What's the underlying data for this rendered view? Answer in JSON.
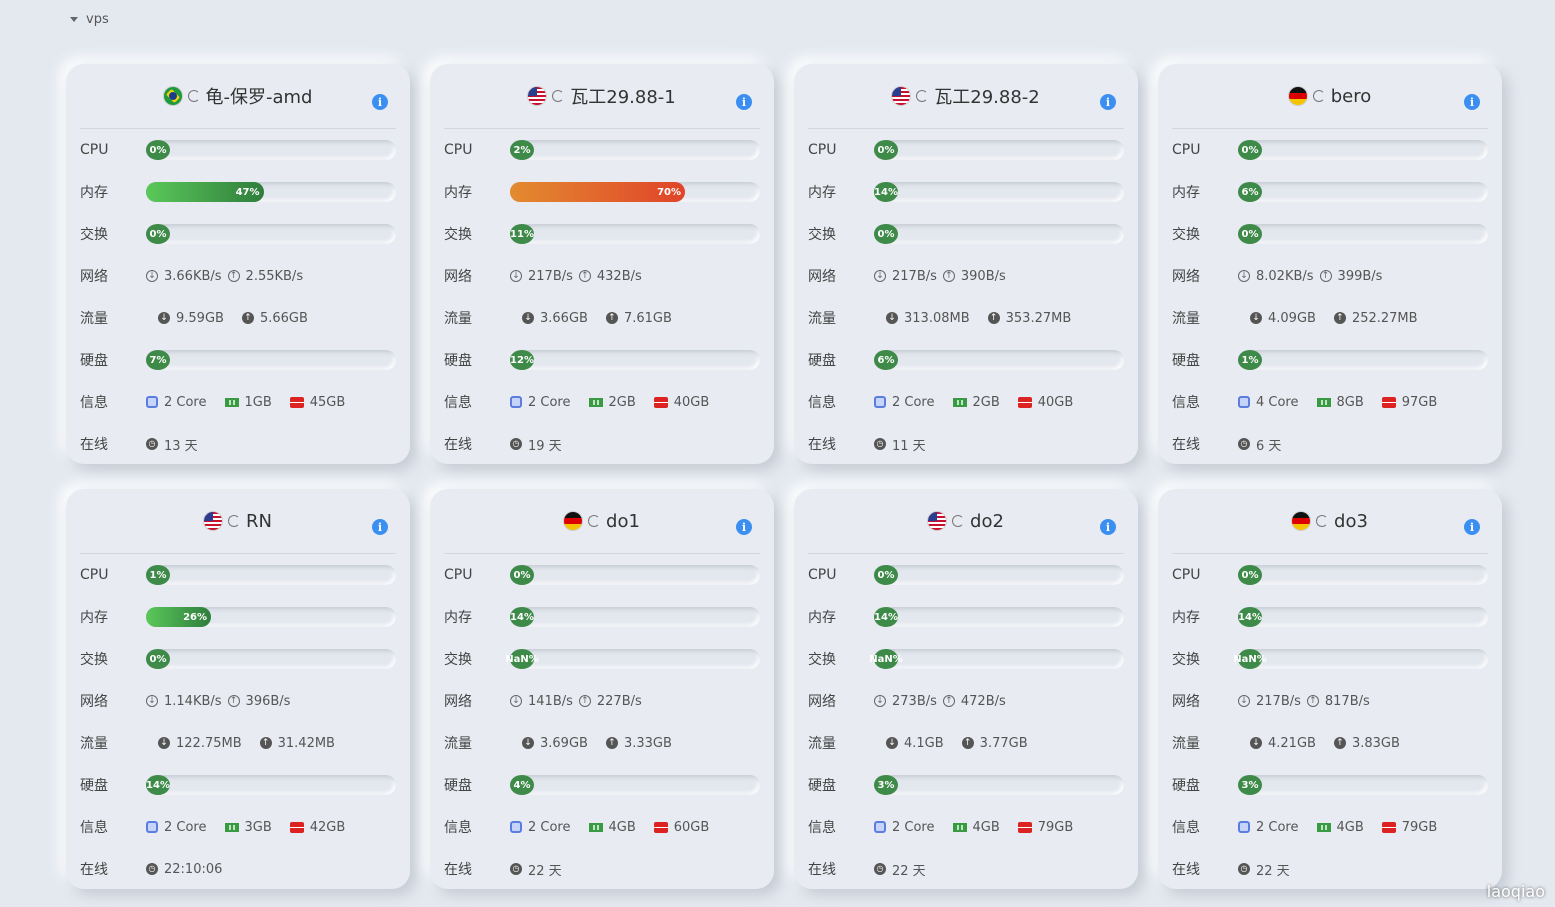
{
  "group": {
    "name": "vps"
  },
  "labels": {
    "cpu": "CPU",
    "mem": "内存",
    "swap": "交换",
    "net": "网络",
    "traffic": "流量",
    "disk": "硬盘",
    "info": "信息",
    "online": "在线"
  },
  "watermark": "laoqiao",
  "servers": [
    {
      "flag": "br",
      "name": "龟-保罗-amd",
      "cpu": "0%",
      "cpu_pct": 0,
      "mem": "47%",
      "mem_pct": 47,
      "swap": "0%",
      "swap_pct": 0,
      "net_in": "3.66KB/s",
      "net_out": "2.55KB/s",
      "traffic_in": "9.59GB",
      "traffic_out": "5.66GB",
      "disk": "7%",
      "disk_pct": 7,
      "cores": "2 Core",
      "ram": "1GB",
      "storage": "45GB",
      "online": "13 天"
    },
    {
      "flag": "us",
      "name": "瓦工29.88-1",
      "cpu": "2%",
      "cpu_pct": 2,
      "mem": "70%",
      "mem_pct": 70,
      "swap": "11%",
      "swap_pct": 11,
      "net_in": "217B/s",
      "net_out": "432B/s",
      "traffic_in": "3.66GB",
      "traffic_out": "7.61GB",
      "disk": "12%",
      "disk_pct": 12,
      "cores": "2 Core",
      "ram": "2GB",
      "storage": "40GB",
      "online": "19 天"
    },
    {
      "flag": "us",
      "name": "瓦工29.88-2",
      "cpu": "0%",
      "cpu_pct": 0,
      "mem": "14%",
      "mem_pct": 14,
      "swap": "0%",
      "swap_pct": 0,
      "net_in": "217B/s",
      "net_out": "390B/s",
      "traffic_in": "313.08MB",
      "traffic_out": "353.27MB",
      "disk": "6%",
      "disk_pct": 6,
      "cores": "2 Core",
      "ram": "2GB",
      "storage": "40GB",
      "online": "11 天"
    },
    {
      "flag": "de",
      "name": "bero",
      "cpu": "0%",
      "cpu_pct": 0,
      "mem": "6%",
      "mem_pct": 6,
      "swap": "0%",
      "swap_pct": 0,
      "net_in": "8.02KB/s",
      "net_out": "399B/s",
      "traffic_in": "4.09GB",
      "traffic_out": "252.27MB",
      "disk": "1%",
      "disk_pct": 1,
      "cores": "4 Core",
      "ram": "8GB",
      "storage": "97GB",
      "online": "6 天"
    },
    {
      "flag": "us",
      "name": "RN",
      "cpu": "1%",
      "cpu_pct": 1,
      "mem": "26%",
      "mem_pct": 26,
      "swap": "0%",
      "swap_pct": 0,
      "net_in": "1.14KB/s",
      "net_out": "396B/s",
      "traffic_in": "122.75MB",
      "traffic_out": "31.42MB",
      "disk": "14%",
      "disk_pct": 14,
      "cores": "2 Core",
      "ram": "3GB",
      "storage": "42GB",
      "online": "22:10:06"
    },
    {
      "flag": "de",
      "name": "do1",
      "cpu": "0%",
      "cpu_pct": 0,
      "mem": "14%",
      "mem_pct": 14,
      "swap": "NaN%",
      "swap_pct": 0,
      "net_in": "141B/s",
      "net_out": "227B/s",
      "traffic_in": "3.69GB",
      "traffic_out": "3.33GB",
      "disk": "4%",
      "disk_pct": 4,
      "cores": "2 Core",
      "ram": "4GB",
      "storage": "60GB",
      "online": "22 天"
    },
    {
      "flag": "us",
      "name": "do2",
      "cpu": "0%",
      "cpu_pct": 0,
      "mem": "14%",
      "mem_pct": 14,
      "swap": "NaN%",
      "swap_pct": 0,
      "net_in": "273B/s",
      "net_out": "472B/s",
      "traffic_in": "4.1GB",
      "traffic_out": "3.77GB",
      "disk": "3%",
      "disk_pct": 3,
      "cores": "2 Core",
      "ram": "4GB",
      "storage": "79GB",
      "online": "22 天"
    },
    {
      "flag": "de",
      "name": "do3",
      "cpu": "0%",
      "cpu_pct": 0,
      "mem": "14%",
      "mem_pct": 14,
      "swap": "NaN%",
      "swap_pct": 0,
      "net_in": "217B/s",
      "net_out": "817B/s",
      "traffic_in": "4.21GB",
      "traffic_out": "3.83GB",
      "disk": "3%",
      "disk_pct": 3,
      "cores": "2 Core",
      "ram": "4GB",
      "storage": "79GB",
      "online": "22 天"
    }
  ]
}
